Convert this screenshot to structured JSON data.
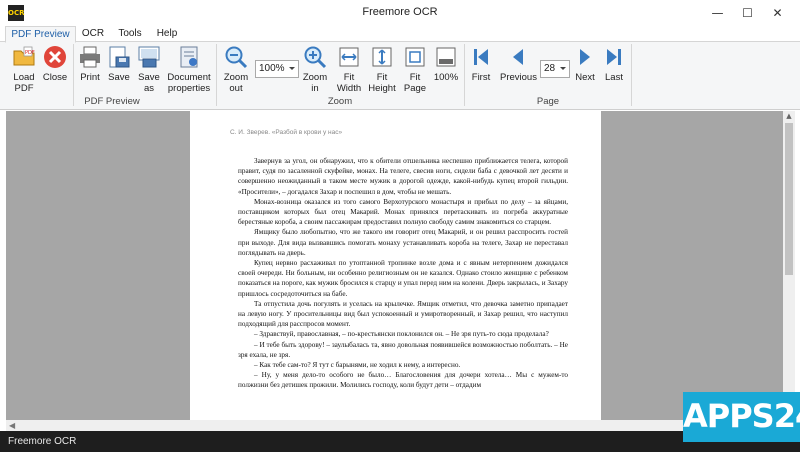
{
  "window": {
    "title": "Freemore OCR",
    "app_icon_text": "OCR",
    "minimize": "—",
    "maximize": "☐",
    "close": "✕"
  },
  "menu": {
    "tabs": [
      "PDF Preview",
      "OCR",
      "Tools",
      "Help"
    ]
  },
  "ribbon": {
    "pdf_group": {
      "label": "PDF Preview",
      "buttons": [
        {
          "label": "Load PDF",
          "icon": "folder-icon"
        },
        {
          "label": "Close",
          "icon": "close-circle-icon"
        },
        {
          "label": "Print",
          "icon": "printer-icon"
        },
        {
          "label": "Save",
          "icon": "save-icon"
        },
        {
          "label": "Save as",
          "icon": "save-as-icon"
        },
        {
          "label": "Document properties",
          "icon": "document-properties-icon"
        }
      ]
    },
    "zoom_group": {
      "label": "Zoom",
      "zoom_value": "100%",
      "buttons": [
        {
          "label": "Zoom out",
          "icon": "zoom-out-icon"
        },
        {
          "label": "Zoom in",
          "icon": "zoom-in-icon"
        },
        {
          "label": "Fit Width",
          "icon": "fit-width-icon"
        },
        {
          "label": "Fit Height",
          "icon": "fit-height-icon"
        },
        {
          "label": "Fit Page",
          "icon": "fit-page-icon"
        },
        {
          "label": "100%",
          "icon": "actual-size-icon"
        }
      ]
    },
    "page_group": {
      "label": "Page",
      "page_value": "28",
      "buttons": [
        {
          "label": "First",
          "icon": "first-page-icon"
        },
        {
          "label": "Previous",
          "icon": "previous-page-icon"
        },
        {
          "label": "Next",
          "icon": "next-page-icon"
        },
        {
          "label": "Last",
          "icon": "last-page-icon"
        }
      ]
    }
  },
  "document": {
    "header": "С. И. Зверев. «Разбой в крови у нас»",
    "paragraphs": [
      "Завернув за угол, он обнаружил, что к обители отшельника неспешно приближается телега, которой правит, судя по засаленной скуфейке, монах. На телеге, свесив ноги, сидели баба с девочкой лет десяти и совершенно неожиданный в таком месте мужик в дорогой одежде, какой-нибудь купец второй гильдии. «Просители», – догадался Захар и поспешил в дом, чтобы не мешать.",
      "Монах-возница оказался из того самого Верхотурского монастыря и прибыл по делу – за яйцами, поставщиком которых был отец Макарий. Монах принялся перетаскивать из погреба аккуратные берестяные короба, а своим пассажирам предоставил полную свободу самим знакомиться со старцем.",
      "Ямщику было любопытно, что же такого им говорит отец Макарий, и он решил расспросить гостей при выходе. Для вида вызвавшись помогать монаху устанавливать короба на телеге, Захар не переставал поглядывать на дверь.",
      "Купец нервно расхаживал по утоптанной тропинке возле дома и с явным нетерпением дожидался своей очереди. Ни больным, ни особенно религиозным он не казался. Однако стоило женщине с ребенком показаться на пороге, как мужик бросился к старцу и упал перед ним на колени. Дверь закрылась, и Захару пришлось сосредоточиться на бабе.",
      "Та отпустила дочь погулять и уселась на крылечке. Ямщик отметил, что девочка заметно припадает на левую ногу. У просительницы вид был успокоенный и умиротворенный, и Захар решил, что наступил подходящий для расспросов момент.",
      "– Здравствуй, православная, – по-крестьянски поклонился он. – Не зря путь-то сюда проделала?",
      "– И тебе быть здорову! – заулыбалась та, явно довольная появившейся возможностью поболтать. – Не зря ехала, не зря.",
      "– Как тебе сам-то? Я тут с барынями, не ходил к нему, а интересно.",
      "– Ну, у меня дело-то особого не было… Благословения для дочери хотела… Мы с мужем-то полжизни без детишек прожили. Молились господу, коли будут дети – отдадим"
    ]
  },
  "statusbar": {
    "text": "Freemore OCR"
  },
  "watermark": {
    "text": "APPS24"
  }
}
